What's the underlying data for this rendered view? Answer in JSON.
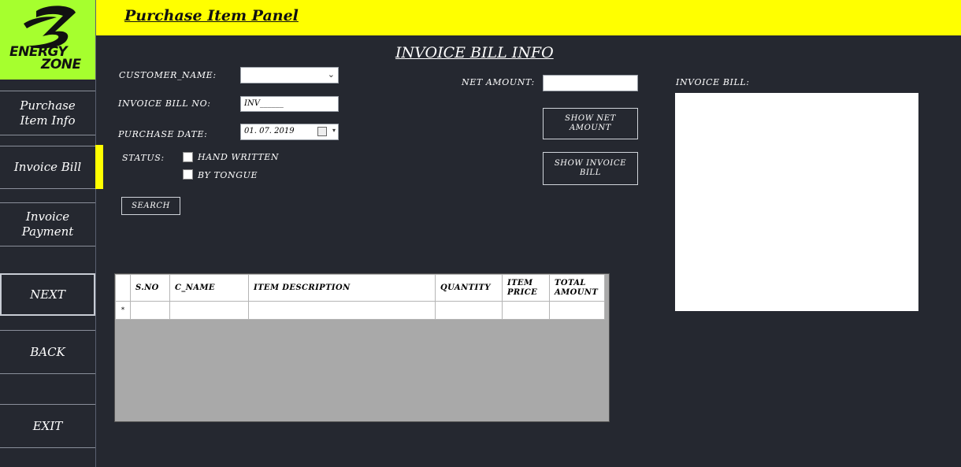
{
  "header": {
    "title": "Purchase Item Panel",
    "accent": "#ffff00"
  },
  "logo": {
    "line1": "ENERGY",
    "line2": "ZONE",
    "background": "#a6ff2e"
  },
  "sidebar": {
    "items": [
      {
        "label": "Purchase Item Info"
      },
      {
        "label": "Invoice Bill",
        "active": true
      },
      {
        "label": "Invoice Payment"
      },
      {
        "label": "NEXT"
      },
      {
        "label": "BACK"
      },
      {
        "label": "EXIT"
      }
    ]
  },
  "form": {
    "section_title": "INVOICE BILL INFO",
    "customer_name_label": "CUSTOMER_NAME:",
    "customer_name_value": "",
    "invoice_no_label": "INVOICE BILL NO:",
    "invoice_no_value": "INV______",
    "purchase_date_label": "PURCHASE DATE:",
    "purchase_date_value": "01. 07. 2019",
    "status_label": "STATUS:",
    "status_options": [
      {
        "label": "HAND WRITTEN",
        "checked": false
      },
      {
        "label": "BY TONGUE",
        "checked": false
      }
    ],
    "search_label": "SEARCH",
    "net_amount_label": "NET AMOUNT:",
    "net_amount_value": "",
    "show_net_amount_label": "SHOW NET AMOUNT",
    "show_invoice_bill_label": "SHOW INVOICE BILL",
    "invoice_bill_label": "INVOICE BILL:"
  },
  "grid": {
    "columns": [
      "S.NO",
      "C_NAME",
      "ITEM DESCRIPTION",
      "QUANTITY",
      "ITEM PRICE",
      "TOTAL AMOUNT"
    ],
    "new_row_marker": "*",
    "rows": [
      [
        "",
        "",
        "",
        "",
        "",
        ""
      ]
    ]
  }
}
